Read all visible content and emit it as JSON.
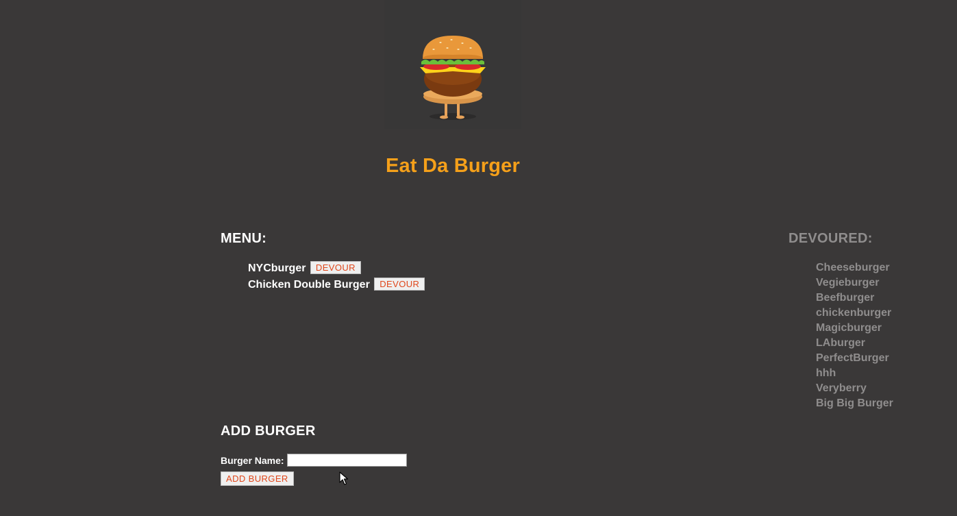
{
  "header": {
    "logo_name": "burger-character-logo",
    "title": "Eat Da Burger"
  },
  "menu": {
    "heading": "MENU:",
    "items": [
      {
        "name": "NYCburger",
        "button": "DEVOUR"
      },
      {
        "name": "Chicken Double Burger",
        "button": "DEVOUR"
      }
    ]
  },
  "devoured": {
    "heading": "DEVOURED:",
    "items": [
      "Cheeseburger",
      "Vegieburger",
      "Beefburger",
      "chickenburger",
      "Magicburger",
      "LAburger",
      "PerfectBurger",
      "hhh",
      "Veryberry",
      "Big Big Burger"
    ]
  },
  "add_form": {
    "heading": "ADD BURGER",
    "label": "Burger Name:",
    "input_value": "",
    "button": "ADD BURGER"
  },
  "colors": {
    "background": "#3a3838",
    "title": "#f5a01a",
    "button_text": "#e0461a",
    "devoured_text": "#8f8d8d"
  }
}
